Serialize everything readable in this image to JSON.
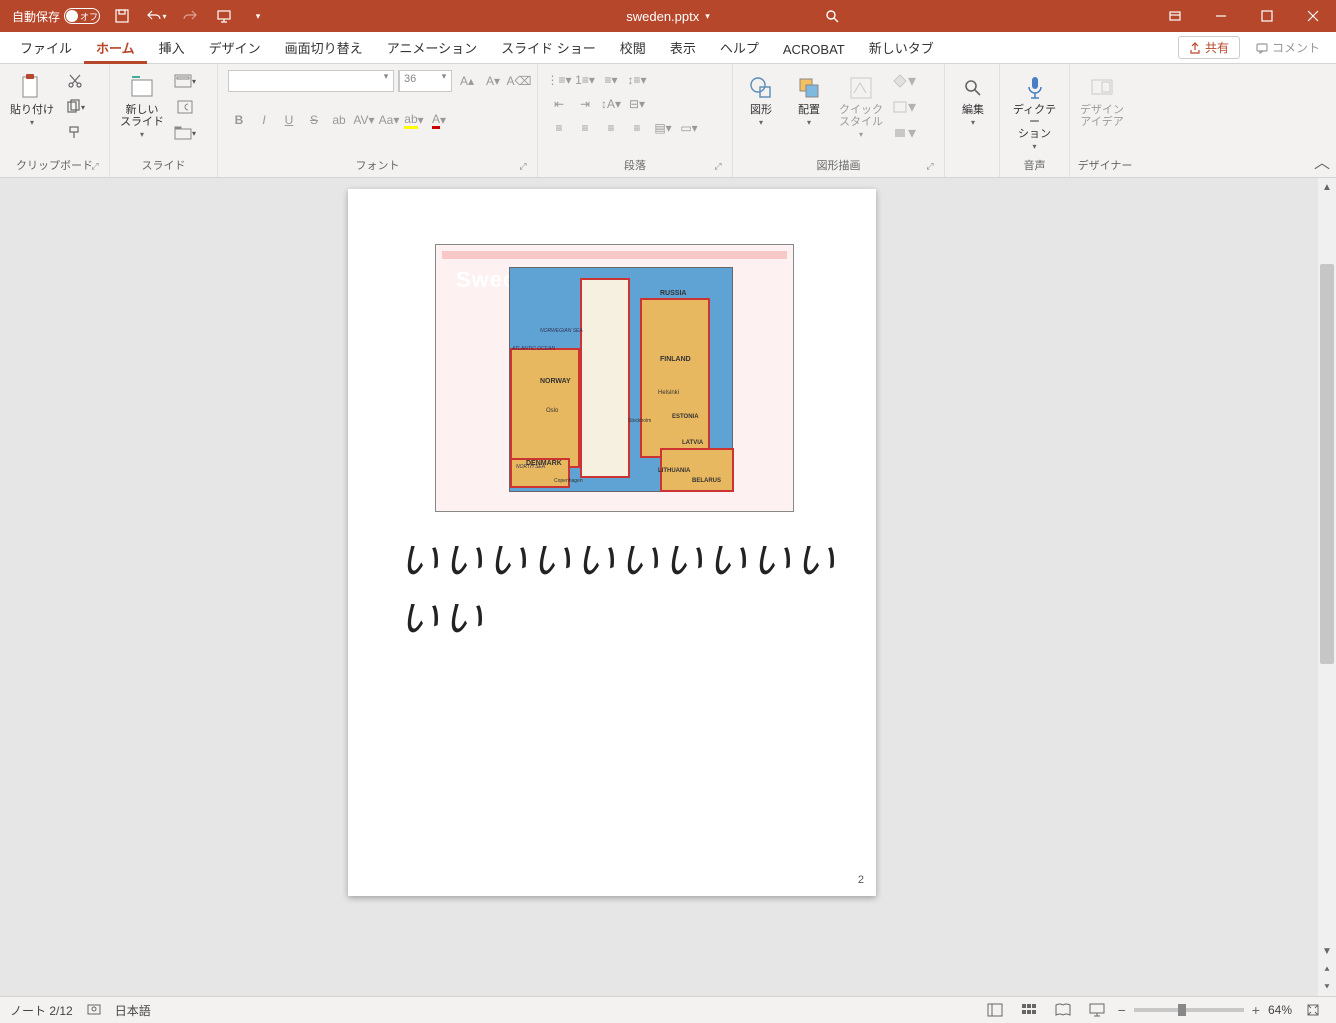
{
  "titlebar": {
    "autosave_label": "自動保存",
    "autosave_state": "オフ",
    "document_name": "sweden.pptx"
  },
  "tabs": {
    "items": [
      "ファイル",
      "ホーム",
      "挿入",
      "デザイン",
      "画面切り替え",
      "アニメーション",
      "スライド ショー",
      "校閲",
      "表示",
      "ヘルプ",
      "ACROBAT",
      "新しいタブ"
    ],
    "active_index": 1,
    "share_label": "共有",
    "comment_label": "コメント"
  },
  "ribbon": {
    "clipboard": {
      "paste_label": "貼り付け",
      "group_label": "クリップボード"
    },
    "slides": {
      "new_slide_label": "新しい\nスライド",
      "group_label": "スライド"
    },
    "font": {
      "font_name": "",
      "font_size": "36",
      "group_label": "フォント"
    },
    "paragraph": {
      "group_label": "段落"
    },
    "drawing": {
      "shapes_label": "図形",
      "arrange_label": "配置",
      "quickstyle_label": "クイック\nスタイル",
      "group_label": "図形描画"
    },
    "editing": {
      "label": "編集"
    },
    "voice": {
      "dictate_label": "ディクテー\nション",
      "group_label": "音声"
    },
    "designer": {
      "ideas_label": "デザイン\nアイデア",
      "group_label": "デザイナー"
    }
  },
  "slide": {
    "title": "Sweden MAP",
    "map_labels": [
      "RUSSIA",
      "FINLAND",
      "Helsinki",
      "ESTONIA",
      "LATVIA",
      "LITHUANIA",
      "BELARUS",
      "DENMARK",
      "Copenhagen",
      "NORWAY",
      "Oslo",
      "NORTH SEA",
      "ATLANTIC OCEAN",
      "NORWEGIAN SEA",
      "Stockholm"
    ],
    "notes_text": "いいいいいいいいいいいい",
    "page_number": "2"
  },
  "status": {
    "section": "ノート 2/12",
    "language": "日本語",
    "zoom": "64%"
  }
}
